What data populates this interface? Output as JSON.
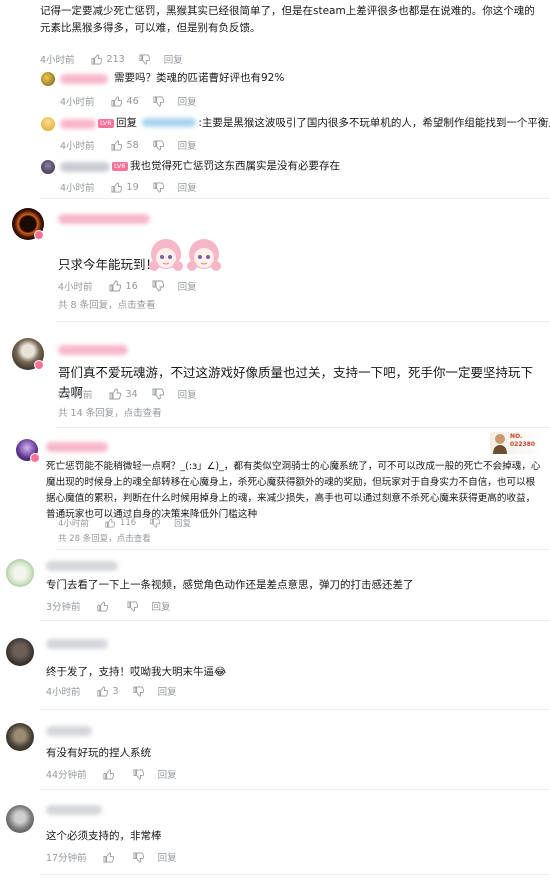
{
  "comments": [
    {
      "text": "记得一定要减少死亡惩罚，黑猴其实已经很简单了，但是在steam上差评很多也都是在说难的。你这个魂的元素比黑猴多得多，可以难，但是别有负反馈。",
      "time": "4小时前",
      "likes": "213",
      "reply_label": "回复"
    },
    {
      "text": "需要吗？类魂的匹诺曹好评也有92%",
      "time": "4小时前",
      "likes": "46",
      "reply_label": "回复"
    },
    {
      "reply_prefix": "回复",
      "text": ":主要是黑猴这波吸引了国内很多不玩单机的人，希望制作组能找到一个平衡点吧",
      "time": "4小时前",
      "likes": "58",
      "reply_label": "回复"
    },
    {
      "text": "我也觉得死亡惩罚这东西属实是没有必要存在",
      "time": "4小时前",
      "likes": "19",
      "reply_label": "回复"
    },
    {
      "text": "只求今年能玩到！",
      "time": "4小时前",
      "likes": "16",
      "reply_label": "回复",
      "more_count": "共 8 条回复，",
      "more_link": "点击查看"
    },
    {
      "text": "哥们真不爱玩魂游，不过这游戏好像质量也过关，支持一下吧，死手你一定要坚持玩下去啊",
      "time": "4小时前",
      "likes": "34",
      "reply_label": "回复",
      "more_count": "共 14 条回复，",
      "more_link": "点击查看"
    },
    {
      "text": "死亡惩罚能不能稍微轻一点啊？_(:з」∠)_，都有类似空洞骑士的心魔系统了，可不可以改成一般的死亡不会掉魂，心魔出现的时候身上的魂全部转移在心魔身上，杀死心魔获得额外的魂的奖励，但玩家对于自身实力不自信，也可以根据心魔值的累积，判断在什么时候用掉身上的魂，来减少损失，高手也可以通过刻意不杀死心魔来获得更高的收益，普通玩家也可以通过自身的决策来降低外门槛这种",
      "time": "4小时前",
      "likes": "116",
      "reply_label": "回复",
      "more_count": "共 28 条回复，",
      "more_link": "点击查看",
      "card_no": "NO.\n022380"
    },
    {
      "text": "专门去看了一下上一条视频，感觉角色动作还是差点意思，弹刀的打击感还差了",
      "time": "3分钟前",
      "likes": "",
      "reply_label": "回复"
    },
    {
      "text": "终于发了，支持！哎呦我大明末牛逼😂",
      "time": "4小时前",
      "likes": "3",
      "reply_label": "回复"
    },
    {
      "text": "有没有好玩的捏人系统",
      "time": "44分钟前",
      "likes": "",
      "reply_label": "回复"
    },
    {
      "text": "这个必须支持的，非常棒",
      "time": "17分钟前",
      "likes": "",
      "reply_label": "回复"
    }
  ],
  "colors": {
    "text": "#18191c",
    "meta": "#9499a0",
    "pink": "#fb7299",
    "link": "#008ac5"
  },
  "level_badge": "LV6"
}
